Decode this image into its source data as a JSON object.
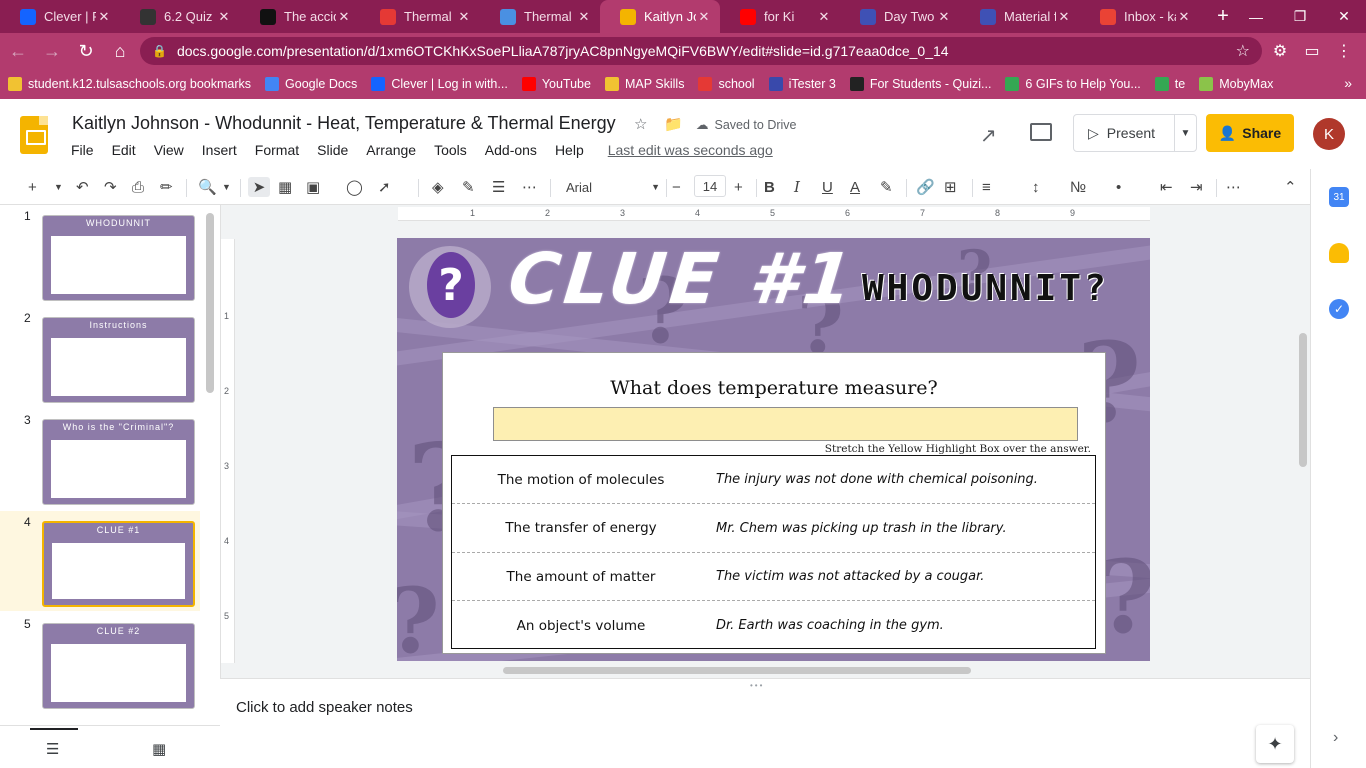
{
  "browser": {
    "tabs": [
      {
        "title": "Clever | Po",
        "icon": "clever-icon",
        "color": "#1464ff"
      },
      {
        "title": "6.2 Quiz",
        "icon": "quiz-icon",
        "color": "#333333"
      },
      {
        "title": "The accid",
        "icon": "bold-b-icon",
        "color": "#111111"
      },
      {
        "title": "Thermal E",
        "icon": "ring-icon",
        "color": "#e53935"
      },
      {
        "title": "Thermal E",
        "icon": "check-icon",
        "color": "#4a90e2"
      },
      {
        "title": "Kaitlyn Jo",
        "icon": "slides-icon",
        "color": "#f4b400",
        "active": true
      },
      {
        "title": "for Ki",
        "icon": "youtube-icon",
        "color": "#ff0000"
      },
      {
        "title": "Day Two",
        "icon": "word-w-icon",
        "color": "#3f51b5"
      },
      {
        "title": "Material f",
        "icon": "word-w-icon",
        "color": "#3f51b5"
      },
      {
        "title": "Inbox - ka",
        "icon": "gmail-icon",
        "color": "#ea4335"
      }
    ],
    "url": "docs.google.com/presentation/d/1xm6OTCKhKxSoePLliaA787jryAC8pnNgyeMQiFV6BWY/edit#slide=id.g717eaa0dce_0_14",
    "bookmarks": [
      {
        "label": "student.k12.tulsaschools.org bookmarks",
        "color": "#f1c232"
      },
      {
        "label": "Google Docs",
        "color": "#4285f4"
      },
      {
        "label": "Clever | Log in with...",
        "color": "#1464ff"
      },
      {
        "label": "YouTube",
        "color": "#ff0000"
      },
      {
        "label": "MAP Skills",
        "color": "#f1c232"
      },
      {
        "label": "school",
        "color": "#e53935"
      },
      {
        "label": "iTester 3",
        "color": "#3949ab"
      },
      {
        "label": "For Students - Quizi...",
        "color": "#222222"
      },
      {
        "label": "6 GIFs to Help You...",
        "color": "#34a853"
      },
      {
        "label": "te",
        "color": "#34a853"
      },
      {
        "label": "MobyMax",
        "color": "#8bc34a"
      }
    ]
  },
  "doc": {
    "title": "Kaitlyn Johnson - Whodunnit - Heat, Temperature & Thermal Energy",
    "saved": "Saved to Drive",
    "menu": [
      "File",
      "Edit",
      "View",
      "Insert",
      "Format",
      "Slide",
      "Arrange",
      "Tools",
      "Add-ons",
      "Help"
    ],
    "last_edit": "Last edit was seconds ago",
    "present_label": "Present",
    "share_label": "Share",
    "avatar_letter": "K"
  },
  "toolbar": {
    "font": "Arial",
    "font_size": "14"
  },
  "filmstrip": {
    "slides": [
      {
        "num": "1",
        "heading": "WHODUNNIT"
      },
      {
        "num": "2",
        "heading": "Instructions"
      },
      {
        "num": "3",
        "heading": "Who is the \"Criminal\"?"
      },
      {
        "num": "4",
        "heading": "CLUE #1",
        "active": true
      },
      {
        "num": "5",
        "heading": "CLUE #2"
      }
    ]
  },
  "ruler": {
    "h": [
      "1",
      "2",
      "3",
      "4",
      "5",
      "6",
      "7",
      "8",
      "9"
    ],
    "v": [
      "1",
      "2",
      "3",
      "4",
      "5"
    ]
  },
  "slide": {
    "clue_title": "CLUE #1",
    "brand": "WHODUNNIT?",
    "question": "What does temperature measure?",
    "stretch_note": "Stretch the Yellow Highlight Box over the answer.",
    "rows": [
      {
        "answer": "The motion of molecules",
        "clue": "The injury was not done with chemical poisoning."
      },
      {
        "answer": "The transfer of energy",
        "clue": "Mr. Chem was picking up trash in the library."
      },
      {
        "answer": "The amount of matter",
        "clue": "The victim was not attacked by a cougar."
      },
      {
        "answer": "An object's volume",
        "clue": "Dr. Earth was coaching in the gym."
      }
    ]
  },
  "notes": {
    "placeholder": "Click to add speaker notes"
  }
}
